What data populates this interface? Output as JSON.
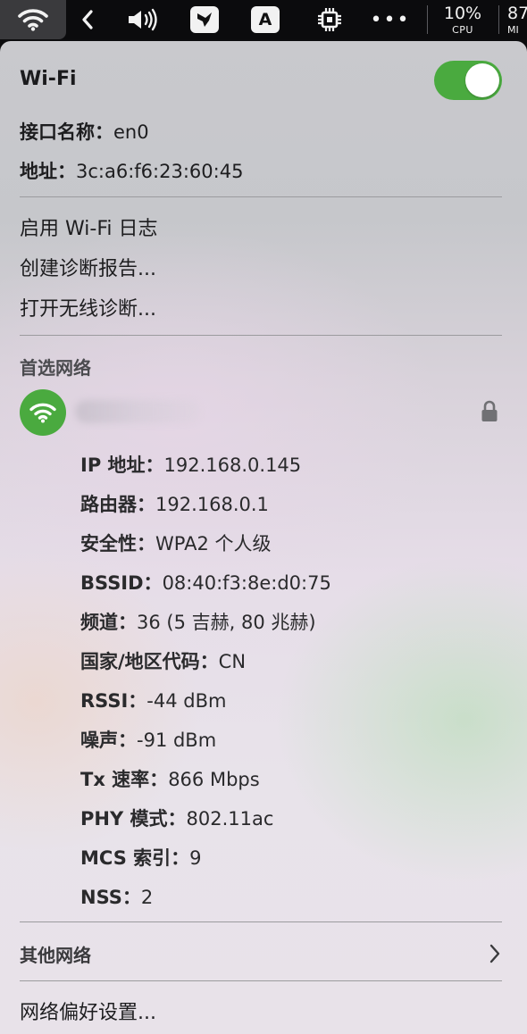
{
  "menubar": {
    "wifi_icon": "wifi-icon",
    "back_icon": "chevron-left-icon",
    "volume_icon": "speaker-volume-icon",
    "app_icon": "bird-app-icon",
    "input_method": "A",
    "chip_icon": "cpu-chip-icon",
    "more_icon": "more-dots-icon",
    "more_text": "•••",
    "cpu_percent": "10%",
    "cpu_label": "CPU",
    "mem_percent": "87",
    "mem_label": "MI"
  },
  "panel": {
    "title": "Wi-Fi",
    "toggle_on": true,
    "toggle_color": "#4aaa3f",
    "interface_label": "接口名称：",
    "interface_value": "en0",
    "address_label": "地址：",
    "address_value": "3c:a6:f6:23:60:45",
    "menu_items": [
      "启用 Wi-Fi 日志",
      "创建诊断报告...",
      "打开无线诊断..."
    ],
    "preferred_section": "首选网络",
    "network": {
      "icon": "wifi-icon",
      "name": "",
      "lock_icon": "lock-icon",
      "details": [
        {
          "label": "IP 地址：",
          "value": "192.168.0.145"
        },
        {
          "label": "路由器：",
          "value": "192.168.0.1"
        },
        {
          "label": "安全性：",
          "value": "WPA2 个人级"
        },
        {
          "label": "BSSID：",
          "value": "08:40:f3:8e:d0:75"
        },
        {
          "label": "频道：",
          "value": "36 (5 吉赫, 80 兆赫)"
        },
        {
          "label": "国家/地区代码：",
          "value": "CN"
        },
        {
          "label": "RSSI：",
          "value": "-44 dBm"
        },
        {
          "label": "噪声：",
          "value": "-91 dBm"
        },
        {
          "label": "Tx 速率：",
          "value": "866 Mbps"
        },
        {
          "label": "PHY 模式：",
          "value": "802.11ac"
        },
        {
          "label": "MCS 索引：",
          "value": "9"
        },
        {
          "label": "NSS：",
          "value": "2"
        }
      ]
    },
    "other_networks": "其他网络",
    "other_networks_icon": "chevron-right-icon",
    "preferences": "网络偏好设置..."
  }
}
